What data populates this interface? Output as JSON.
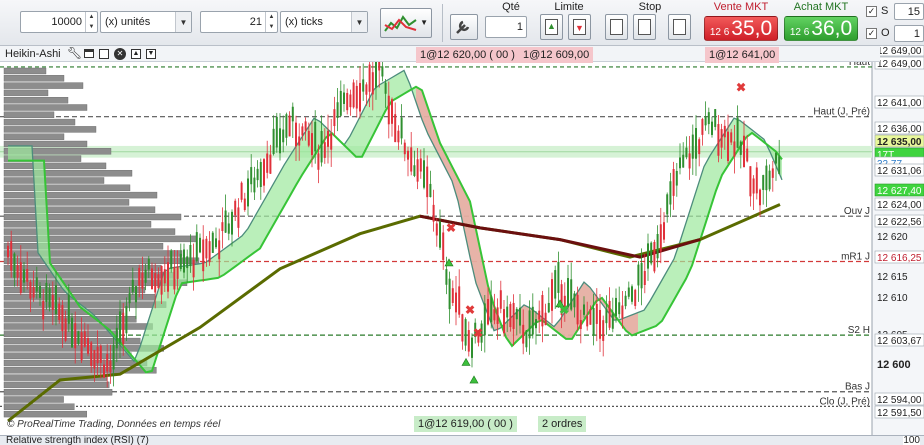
{
  "toolbar": {
    "qty_value": "10000",
    "unit_label": "(x) unités",
    "ticks_value": "21",
    "ticks_label": "(x) ticks",
    "qte_label": "Qté",
    "qte_value": "1",
    "limite_label": "Limite",
    "stop_label": "Stop",
    "sell_label": "Vente MKT",
    "sell_prefix": "12 6",
    "sell_price": "35,0",
    "buy_label": "Achat MKT",
    "buy_prefix": "12 6",
    "buy_price": "36,0",
    "s_label": "S",
    "s_value": "15",
    "o_label": "O",
    "o_value": "1"
  },
  "chart": {
    "title": "Heikin-Ashi",
    "tags_top": [
      "1@12 620,00 ( 00 )",
      "1@12 609,00",
      "1@12 641,00"
    ],
    "tags_bottom": [
      "1@12 619,00 ( 00 )",
      "2 ordres"
    ],
    "watermark": "© ProRealTime Trading, Données en temps réel",
    "level_labels": [
      {
        "text": "Haut",
        "price": 12649.5
      },
      {
        "text": "Haut (J, Pré)",
        "price": 12641
      },
      {
        "text": "Ouv J",
        "price": 12624
      },
      {
        "text": "mR1 J",
        "price": 12616.25
      },
      {
        "text": "S2 H",
        "price": 12603.67
      },
      {
        "text": "Bas J",
        "price": 12594
      },
      {
        "text": "Clo (J, Pré)",
        "price": 12591.5
      }
    ],
    "price_ticks": [
      {
        "text": "12 649,00",
        "style": "boxed"
      },
      {
        "text": "12 649,00",
        "style": "boxed"
      },
      {
        "text": "12 641,00",
        "style": "boxed"
      },
      {
        "text": "12 636,00",
        "style": "boxed"
      },
      {
        "text": "12 635,00",
        "style": "current"
      },
      {
        "text": "17T",
        "style": "green"
      },
      {
        "text": "32,77",
        "style": "blue"
      },
      {
        "text": "12 631,06",
        "style": "boxed"
      },
      {
        "text": "12 627,40",
        "style": "green"
      },
      {
        "text": "12 624,00",
        "style": "boxed"
      },
      {
        "text": "12 622,56",
        "style": "boxed"
      },
      {
        "text": "12 620",
        "style": "plain"
      },
      {
        "text": "12 616,25",
        "style": "boxed-red"
      },
      {
        "text": "12 615",
        "style": "plain"
      },
      {
        "text": "12 610",
        "style": "plain"
      },
      {
        "text": "12 605",
        "style": "plain"
      },
      {
        "text": "12 603,67",
        "style": "boxed"
      },
      {
        "text": "12 600",
        "style": "bold"
      },
      {
        "text": "12 594,00",
        "style": "boxed"
      },
      {
        "text": "12 591,50",
        "style": "boxed"
      }
    ],
    "colors": {
      "bull": "#2f8f2f",
      "bear": "#e0303a",
      "sma": "#6b0f0f",
      "lwma": "#5a6b00",
      "band_up": "#9de89d",
      "band_down": "#f3a4a4",
      "dark_band": "#4c8c7c",
      "volume": "#8d8d8d"
    }
  },
  "rsi": {
    "label": "Relative strength index (RSI) (7)",
    "value": "100"
  }
}
